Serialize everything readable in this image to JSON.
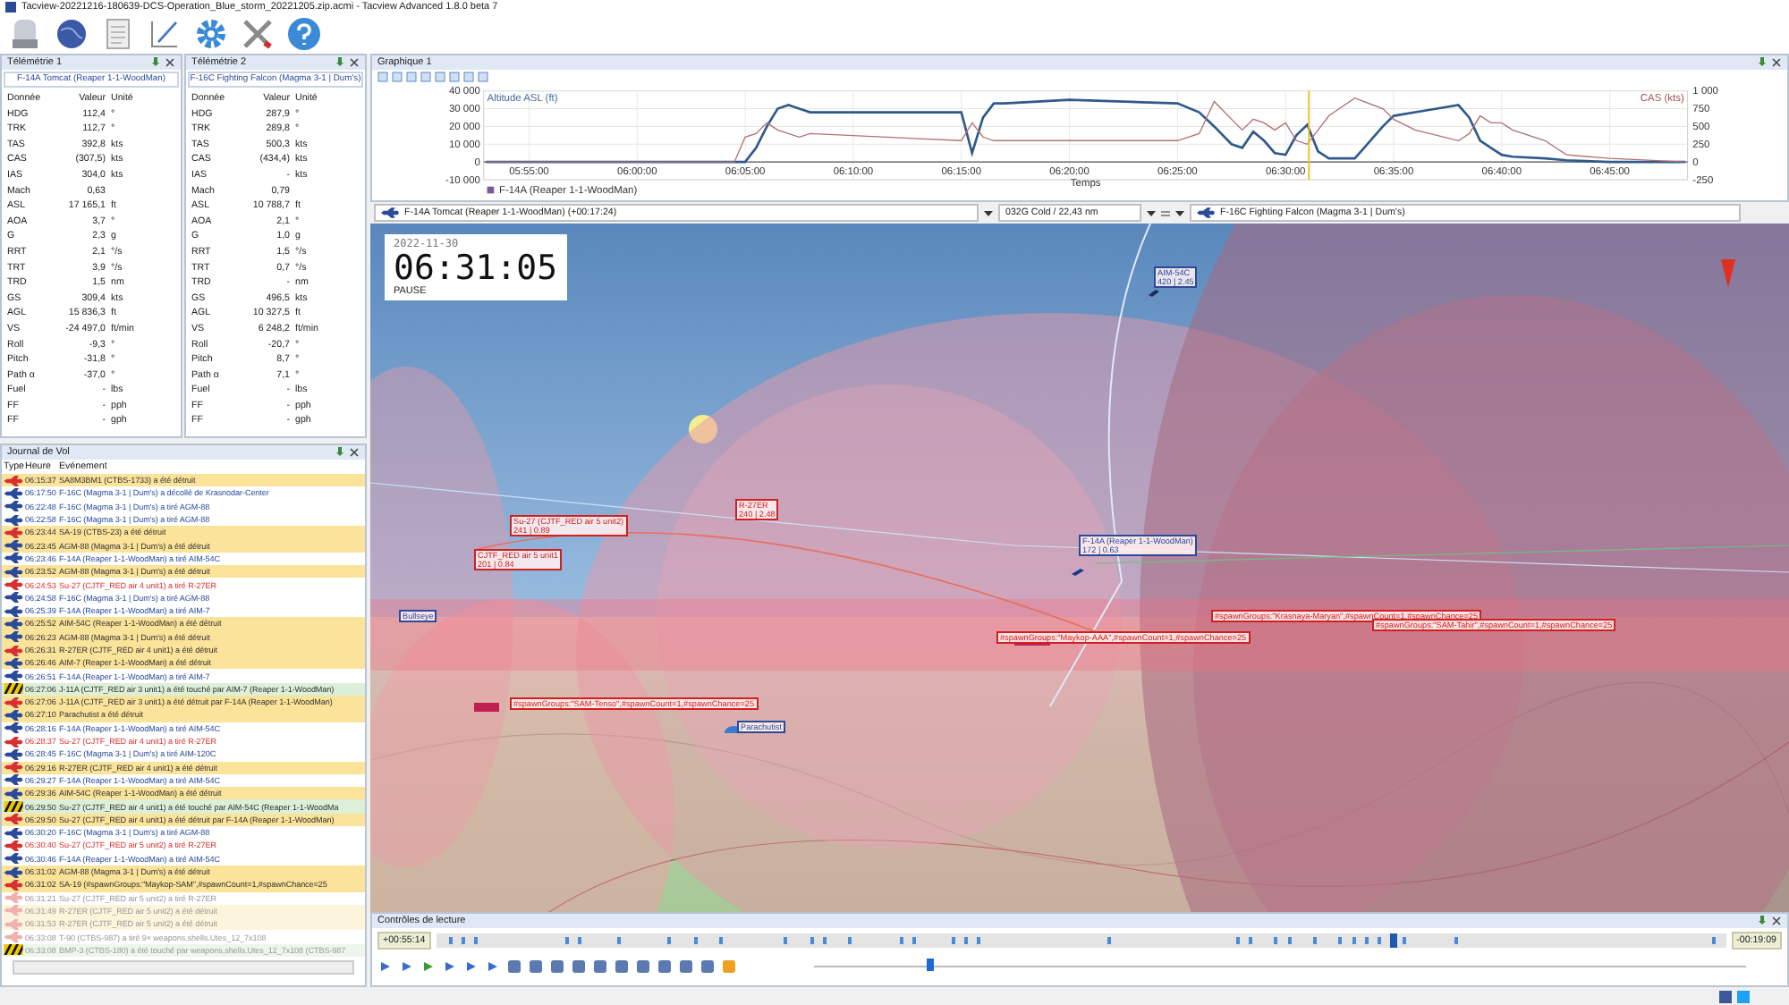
{
  "window": {
    "title": "Tacview-20221216-180639-DCS-Operation_Blue_storm_20221205.zip.acmi - Tacview Advanced 1.8.0 beta 7"
  },
  "telemetry": [
    {
      "title": "Télémétrie 1",
      "aircraft": "F-14A Tomcat (Reaper 1-1-WoodMan)",
      "columns": [
        "Donnée",
        "Valeur",
        "Unité"
      ],
      "rows": [
        [
          "HDG",
          "112,4",
          "°"
        ],
        [
          "TRK",
          "112,7",
          "°"
        ],
        [
          "TAS",
          "392,8",
          "kts"
        ],
        [
          "CAS",
          "(307,5)",
          "kts"
        ],
        [
          "IAS",
          "304,0",
          "kts"
        ],
        [
          "Mach",
          "0,63",
          ""
        ],
        [
          "ASL",
          "17 165,1",
          "ft"
        ],
        [
          "AOA",
          "3,7",
          "°"
        ],
        [
          "G",
          "2,3",
          "g"
        ],
        [
          "RRT",
          "2,1",
          "°/s"
        ],
        [
          "TRT",
          "3,9",
          "°/s"
        ],
        [
          "TRD",
          "1,5",
          "nm"
        ],
        [
          "GS",
          "309,4",
          "kts"
        ],
        [
          "AGL",
          "15 836,3",
          "ft"
        ],
        [
          "VS",
          "-24 497,0",
          "ft/min"
        ],
        [
          "Roll",
          "-9,3",
          "°"
        ],
        [
          "Pitch",
          "-31,8",
          "°"
        ],
        [
          "Path α",
          "-37,0",
          "°"
        ],
        [
          "Fuel",
          "-",
          "lbs"
        ],
        [
          "FF",
          "-",
          "pph"
        ],
        [
          "FF",
          "-",
          "gph"
        ]
      ]
    },
    {
      "title": "Télémétrie 2",
      "aircraft": "F-16C Fighting Falcon (Magma 3-1 | Dum's)",
      "columns": [
        "Donnée",
        "Valeur",
        "Unité"
      ],
      "rows": [
        [
          "HDG",
          "287,9",
          "°"
        ],
        [
          "TRK",
          "289,8",
          "°"
        ],
        [
          "TAS",
          "500,3",
          "kts"
        ],
        [
          "CAS",
          "(434,4)",
          "kts"
        ],
        [
          "IAS",
          "-",
          "kts"
        ],
        [
          "Mach",
          "0,79",
          ""
        ],
        [
          "ASL",
          "10 788,7",
          "ft"
        ],
        [
          "AOA",
          "2,1",
          "°"
        ],
        [
          "G",
          "1,0",
          "g"
        ],
        [
          "RRT",
          "1,5",
          "°/s"
        ],
        [
          "TRT",
          "0,7",
          "°/s"
        ],
        [
          "TRD",
          "-",
          "nm"
        ],
        [
          "GS",
          "496,5",
          "kts"
        ],
        [
          "AGL",
          "10 327,5",
          "ft"
        ],
        [
          "VS",
          "6 248,2",
          "ft/min"
        ],
        [
          "Roll",
          "-20,7",
          "°"
        ],
        [
          "Pitch",
          "8,7",
          "°"
        ],
        [
          "Path α",
          "7,1",
          "°"
        ],
        [
          "Fuel",
          "-",
          "lbs"
        ],
        [
          "FF",
          "-",
          "pph"
        ],
        [
          "FF",
          "-",
          "gph"
        ]
      ]
    }
  ],
  "journal": {
    "title": "Journal de Vol",
    "columns": [
      "Type",
      "Heure",
      "Evénement"
    ],
    "rows": [
      {
        "time": "06:15:37",
        "event": "SA8M3BM1 (CTBS-1733) a été détruit",
        "kind": "destroyed",
        "color": "#d83030",
        "future": false
      },
      {
        "time": "06:17:50",
        "event": "F-16C (Magma 3-1 | Dum's) a décollé de Krasnodar-Center",
        "kind": "event",
        "color": "#2a4a9a",
        "future": false
      },
      {
        "time": "06:22:48",
        "event": "F-16C (Magma 3-1 | Dum's) a tiré AGM-88",
        "kind": "fired",
        "color": "#2a4a9a",
        "future": false
      },
      {
        "time": "06:22:58",
        "event": "F-16C (Magma 3-1 | Dum's) a tiré AGM-88",
        "kind": "fired",
        "color": "#2a4a9a",
        "future": false
      },
      {
        "time": "06:23:44",
        "event": "SA-19 (CTBS-23) a été détruit",
        "kind": "destroyed",
        "color": "#d83030",
        "future": false
      },
      {
        "time": "06:23:45",
        "event": "AGM-88 (Magma 3-1 | Dum's) a été détruit",
        "kind": "destroyed",
        "color": "#2a4a9a",
        "future": false
      },
      {
        "time": "06:23:46",
        "event": "F-14A (Reaper 1-1-WoodMan) a tiré AIM-54C",
        "kind": "fired",
        "color": "#2a4a9a",
        "future": false
      },
      {
        "time": "06:23:52",
        "event": "AGM-88 (Magma 3-1 | Dum's) a été détruit",
        "kind": "destroyed",
        "color": "#2a4a9a",
        "future": false
      },
      {
        "time": "06:24:53",
        "event": "Su-27 (CJTF_RED air 4 unit1) a tiré R-27ER",
        "kind": "fired",
        "color": "#d83030",
        "future": false
      },
      {
        "time": "06:24:58",
        "event": "F-16C (Magma 3-1 | Dum's) a tiré AGM-88",
        "kind": "fired",
        "color": "#2a4a9a",
        "future": false
      },
      {
        "time": "06:25:39",
        "event": "F-14A (Reaper 1-1-WoodMan) a tiré AIM-7",
        "kind": "fired",
        "color": "#2a4a9a",
        "future": false
      },
      {
        "time": "06:25:52",
        "event": "AIM-54C (Reaper 1-1-WoodMan) a été détruit",
        "kind": "destroyed",
        "color": "#2a4a9a",
        "future": false
      },
      {
        "time": "06:26:23",
        "event": "AGM-88 (Magma 3-1 | Dum's) a été détruit",
        "kind": "destroyed",
        "color": "#2a4a9a",
        "future": false
      },
      {
        "time": "06:26:31",
        "event": "R-27ER (CJTF_RED air 4 unit1) a été détruit",
        "kind": "destroyed",
        "color": "#d83030",
        "future": false
      },
      {
        "time": "06:26:46",
        "event": "AIM-7 (Reaper 1-1-WoodMan) a été détruit",
        "kind": "destroyed",
        "color": "#2a4a9a",
        "future": false
      },
      {
        "time": "06:26:51",
        "event": "F-14A (Reaper 1-1-WoodMan) a tiré AIM-7",
        "kind": "fired",
        "color": "#2a4a9a",
        "future": false
      },
      {
        "time": "06:27:06",
        "event": "J-11A (CJTF_RED air 3 unit1) a été touché par AIM-7 (Reaper 1-1-WoodMan)",
        "kind": "hit",
        "future": false
      },
      {
        "time": "06:27:06",
        "event": "J-11A (CJTF_RED air 3 unit1) a été détruit par F-14A (Reaper 1-1-WoodMan)",
        "kind": "destroyed",
        "color": "#d83030",
        "future": false
      },
      {
        "time": "06:27:10",
        "event": "Parachutist a été détruit",
        "kind": "destroyed",
        "color": "#2a4a9a",
        "future": false
      },
      {
        "time": "06:28:16",
        "event": "F-14A (Reaper 1-1-WoodMan) a tiré AIM-54C",
        "kind": "fired",
        "color": "#2a4a9a",
        "future": false
      },
      {
        "time": "06:28:37",
        "event": "Su-27 (CJTF_RED air 4 unit1) a tiré R-27ER",
        "kind": "fired",
        "color": "#d83030",
        "future": false
      },
      {
        "time": "06:28:45",
        "event": "F-16C (Magma 3-1 | Dum's) a tiré AIM-120C",
        "kind": "fired",
        "color": "#2a4a9a",
        "future": false
      },
      {
        "time": "06:29:16",
        "event": "R-27ER (CJTF_RED air 4 unit1) a été détruit",
        "kind": "destroyed",
        "color": "#d83030",
        "future": false
      },
      {
        "time": "06:29:27",
        "event": "F-14A (Reaper 1-1-WoodMan) a tiré AIM-54C",
        "kind": "fired",
        "color": "#2a4a9a",
        "future": false
      },
      {
        "time": "06:29:36",
        "event": "AIM-54C (Reaper 1-1-WoodMan) a été détruit",
        "kind": "destroyed",
        "color": "#2a4a9a",
        "future": false
      },
      {
        "time": "06:29:50",
        "event": "Su-27 (CJTF_RED air 4 unit1) a été touché par AIM-54C (Reaper 1-1-WoodMa",
        "kind": "hit",
        "future": false
      },
      {
        "time": "06:29:50",
        "event": "Su-27 (CJTF_RED air 4 unit1) a été détruit par F-14A (Reaper 1-1-WoodMan)",
        "kind": "destroyed",
        "color": "#d83030",
        "future": false
      },
      {
        "time": "06:30:20",
        "event": "F-16C (Magma 3-1 | Dum's) a tiré AGM-88",
        "kind": "fired",
        "color": "#2a4a9a",
        "future": false
      },
      {
        "time": "06:30:40",
        "event": "Su-27 (CJTF_RED air 5 unit2) a tiré R-27ER",
        "kind": "fired",
        "color": "#d83030",
        "future": false
      },
      {
        "time": "06:30:46",
        "event": "F-14A (Reaper 1-1-WoodMan) a tiré AIM-54C",
        "kind": "fired",
        "color": "#2a4a9a",
        "future": false
      },
      {
        "time": "06:31:02",
        "event": "AGM-88 (Magma 3-1 | Dum's) a été détruit",
        "kind": "destroyed",
        "color": "#2a4a9a",
        "future": false
      },
      {
        "time": "06:31:02",
        "event": "SA-19 (#spawnGroups:\"Maykop-SAM\",#spawnCount=1,#spawnChance=25",
        "kind": "destroyed",
        "color": "#d83030",
        "future": false
      },
      {
        "time": "06:31:21",
        "event": "Su-27 (CJTF_RED air 5 unit2) a tiré R-27ER",
        "kind": "fired",
        "color": "#f0b0b0",
        "future": true
      },
      {
        "time": "06:31:49",
        "event": "R-27ER (CJTF_RED air 5 unit2) a été détruit",
        "kind": "destroyed",
        "color": "#f0b0b0",
        "future": true
      },
      {
        "time": "06:31:53",
        "event": "R-27ER (CJTF_RED air 5 unit2) a été détruit",
        "kind": "destroyed",
        "color": "#f0b0b0",
        "future": true
      },
      {
        "time": "06:33:08",
        "event": "T-90 (CTBS-987) a tiré 9× weapons.shells.Utes_12_7x108",
        "kind": "fired",
        "color": "#f0b0b0",
        "future": true
      },
      {
        "time": "06:33:08",
        "event": "BMP-3 (CTBS-180) a été touché par weapons.shells.Utes_12_7x108 (CTBS-987",
        "kind": "hit",
        "future": true
      }
    ]
  },
  "graph": {
    "title": "Graphique 1",
    "legend": "F-14A (Reaper 1-1-WoodMan)",
    "chart_data": {
      "type": "line",
      "xlabel": "Temps",
      "grid": true,
      "x": [
        353,
        364,
        364.5,
        365,
        365.5,
        366,
        366.5,
        367,
        367.5,
        368,
        375,
        375.5,
        376,
        376.5,
        377,
        380,
        385,
        386,
        386.7,
        387.5,
        388,
        388.5,
        389,
        389.5,
        390,
        390.5,
        391,
        391.5,
        392,
        393.2,
        394.5,
        395,
        396,
        398,
        398.5,
        399,
        399.5,
        400,
        400.5,
        402,
        403,
        405,
        408.5
      ],
      "series": [
        {
          "name": "Altitude ASL (ft)",
          "color": "#2f5a8a",
          "values": [
            0,
            0,
            0,
            0,
            8000,
            20000,
            30000,
            32000,
            30000,
            28000,
            28000,
            5000,
            25000,
            33000,
            33000,
            35000,
            33000,
            28000,
            20000,
            10000,
            8000,
            17000,
            12000,
            5000,
            4000,
            15000,
            21000,
            6000,
            2000,
            2000,
            20000,
            26000,
            28000,
            32000,
            25000,
            12000,
            8000,
            4000,
            3000,
            2000,
            1000,
            0,
            0
          ]
        },
        {
          "name": "CAS (kts)",
          "color": "#b07070",
          "axis": "y2",
          "values": [
            0,
            0,
            0,
            350,
            400,
            550,
            450,
            400,
            350,
            400,
            300,
            550,
            350,
            300,
            300,
            300,
            300,
            400,
            850,
            600,
            450,
            600,
            550,
            450,
            550,
            300,
            250,
            450,
            650,
            900,
            750,
            600,
            450,
            300,
            400,
            650,
            550,
            550,
            450,
            300,
            100,
            50,
            0
          ]
        }
      ],
      "xlim": [
        352.9,
        408.6
      ],
      "ylim": [
        -10000,
        40000
      ],
      "y2lim": [
        -250,
        1000
      ],
      "xticks": [
        {
          "value": 355,
          "label": "05:55:00"
        },
        {
          "value": 360,
          "label": "06:00:00"
        },
        {
          "value": 365,
          "label": "06:05:00"
        },
        {
          "value": 370,
          "label": "06:10:00"
        },
        {
          "value": 375,
          "label": "06:15:00"
        },
        {
          "value": 380,
          "label": "06:20:00"
        },
        {
          "value": 385,
          "label": "06:25:00"
        },
        {
          "value": 390,
          "label": "06:30:00"
        },
        {
          "value": 395,
          "label": "06:35:00"
        },
        {
          "value": 400,
          "label": "06:40:00"
        },
        {
          "value": 405,
          "label": "06:45:00"
        }
      ],
      "yticks": [
        {
          "value": -10000,
          "label": "-10 000"
        },
        {
          "value": 0,
          "label": "0"
        },
        {
          "value": 10000,
          "label": "10 000"
        },
        {
          "value": 20000,
          "label": "20 000"
        },
        {
          "value": 30000,
          "label": "30 000"
        },
        {
          "value": 40000,
          "label": "40 000"
        }
      ],
      "y2ticks": [
        {
          "value": -250,
          "label": "-250"
        },
        {
          "value": 0,
          "label": "0"
        },
        {
          "value": 250,
          "label": "250"
        },
        {
          "value": 500,
          "label": "500"
        },
        {
          "value": 750,
          "label": "750"
        },
        {
          "value": 1000,
          "label": "1 000"
        }
      ],
      "ref_lines": [
        {
          "axis": "x",
          "value": 391.08,
          "color": "#f0c020"
        }
      ]
    }
  },
  "selector": {
    "left": "F-14A Tomcat (Reaper 1-1-WoodMan) (+00:17:24)",
    "middle": "032G Cold / 22,43 nm",
    "right": "F-16C Fighting Falcon (Magma 3-1 | Dum's)"
  },
  "scene": {
    "date": "2022-11-30",
    "time": "06:31:05",
    "status": "PAUSE",
    "labels": [
      {
        "lines": [
          "AIM-54C",
          "420 | 2.45"
        ],
        "color": "#2a4a9a"
      },
      {
        "lines": [
          "R-27ER",
          "240 | 2.48"
        ],
        "color": "#d02020"
      },
      {
        "lines": [
          "Su-27 (CJTF_RED air 5 unit2)",
          "241 | 0.89"
        ],
        "color": "#d02020"
      },
      {
        "lines": [
          "CJTF_RED air 5 unit1",
          "201 | 0.84"
        ],
        "color": "#d02020"
      },
      {
        "lines": [
          "F-14A (Reaper 1-1-WoodMan)",
          "172 | 0.63"
        ],
        "color": "#2a4a9a"
      },
      {
        "lines": [
          "Bullseye"
        ],
        "color": "#2a4a9a"
      },
      {
        "lines": [
          "Parachutist"
        ],
        "color": "#2a4a9a"
      },
      {
        "lines": [
          "#spawnGroups:\"SAM-Tenso\",#spawnCount=1,#spawnChance=25"
        ],
        "color": "#d02020"
      },
      {
        "lines": [
          "#spawnGroups:\"Maykop-AAA\",#spawnCount=1,#spawnChance=25"
        ],
        "color": "#d02020"
      },
      {
        "lines": [
          "#spawnGroups:\"Krasnaya-Maryan\",#spawnCount=1,#spawnChance=25"
        ],
        "color": "#d02020"
      },
      {
        "lines": [
          "#spawnGroups:\"SAM-Tahir\",#spawnCount=1,#spawnChance=25"
        ],
        "color": "#d02020"
      }
    ]
  },
  "playback": {
    "title": "Contrôles de lecture",
    "elapsed": "+00:55:14",
    "remaining": "-00:19:09",
    "position": {
      "level": 0.74
    },
    "speed": {
      "level": 0.12
    }
  }
}
